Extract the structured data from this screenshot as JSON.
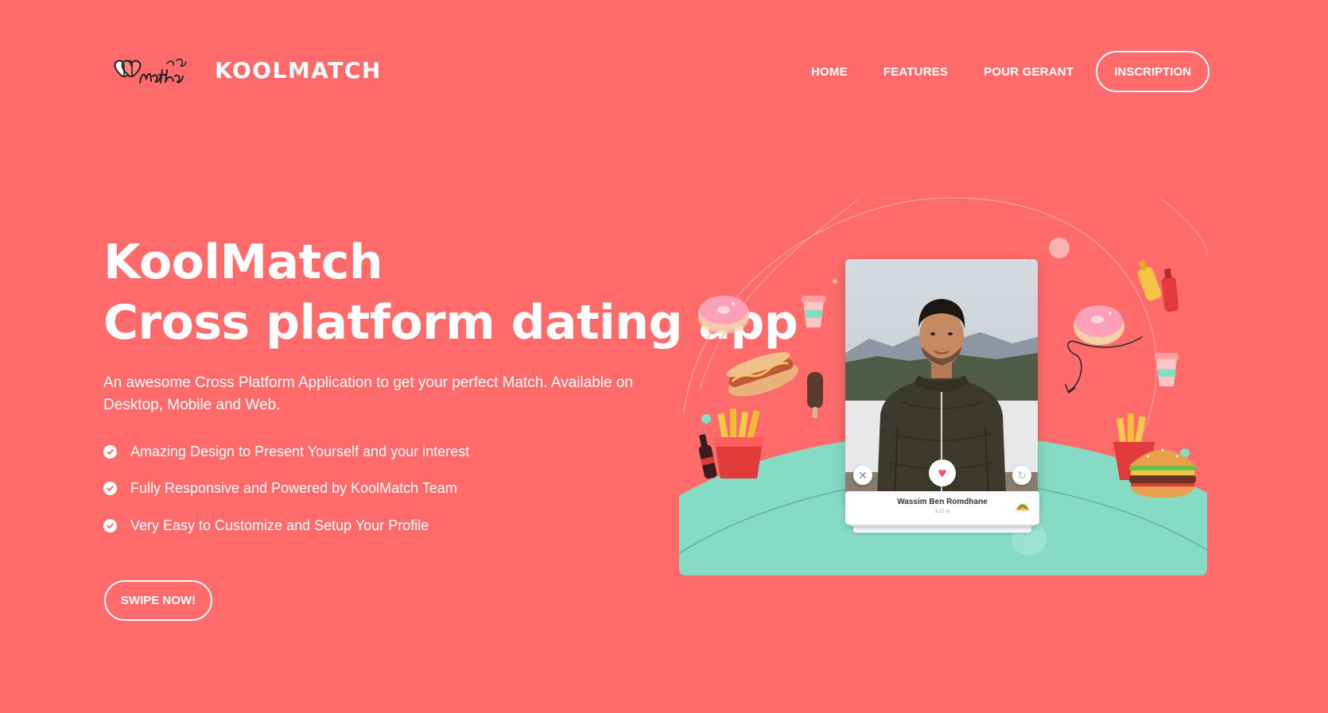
{
  "header": {
    "brand": "KOOLMATCH",
    "nav": [
      "HOME",
      "FEATURES",
      "POUR GERANT"
    ],
    "cta": "INSCRIPTION"
  },
  "hero": {
    "title_line1": "KoolMatch",
    "title_line2": "Cross platform dating app",
    "description": "An awesome Cross Platform Application to get your perfect Match. Available on Desktop, Mobile and Web.",
    "features": [
      "Amazing Design to Present Yourself and your interest",
      "Fully Responsive and Powered by KoolMatch Team",
      "Very Easy to Customize and Setup Your Profile"
    ],
    "cta": "SWIPE NOW!"
  },
  "profile_card": {
    "name": "Wassim Ben Romdhane",
    "distance": "à 12 m",
    "emoji_icon": "taco-icon"
  },
  "colors": {
    "background": "#ff6b6b",
    "mint": "#86dbc4",
    "white": "#ffffff"
  }
}
